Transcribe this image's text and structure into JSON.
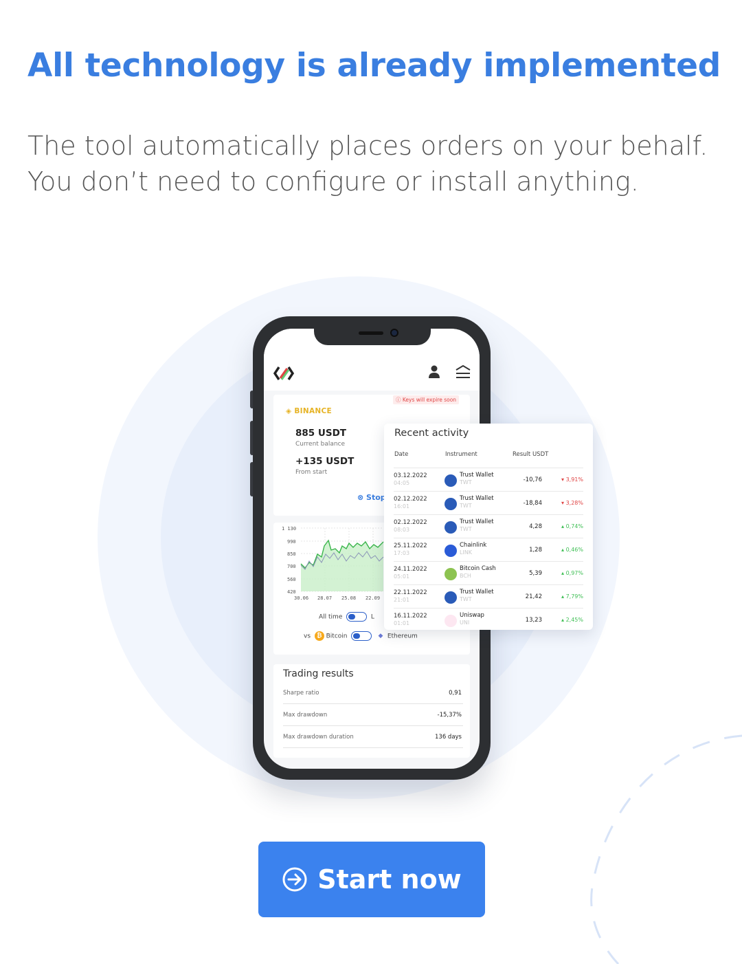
{
  "headline": "All technology is already implemented",
  "subtext": {
    "line1": "The tool automatically places orders on your behalf.",
    "line2": "You don’t need to configure or install anything."
  },
  "colors": {
    "brand_blue": "#3a7ee0",
    "cta_blue": "#3b82ee",
    "positive": "#3fbf55",
    "negative": "#e04545",
    "binance_gold": "#e6b325"
  },
  "phone": {
    "header_icons": [
      "user-icon",
      "menu-icon"
    ],
    "exchange": {
      "name": "BINANCE",
      "warning": "ⓘ Keys will expire soon",
      "balance": "885 USDT",
      "balance_label": "Current balance",
      "profit": "+135 USDT",
      "profit_label": "From start",
      "stop_label": "⊗ Stop"
    },
    "chart": {
      "y_ticks": [
        "1 130",
        "990",
        "850",
        "700",
        "560",
        "420"
      ],
      "x_ticks": [
        "30.06",
        "28.07",
        "25.08",
        "22.09"
      ],
      "toggle_all_time": "All time",
      "toggle_all_time_extra": "L",
      "vs_label": "vs",
      "coin_bitcoin": "Bitcoin",
      "coin_ethereum": "Ethereum"
    },
    "trading_results": {
      "title": "Trading results",
      "rows": [
        {
          "label": "Sharpe ratio",
          "value": "0,91"
        },
        {
          "label": "Max drawdown",
          "value": "-15,37%"
        },
        {
          "label": "Max drawdown duration",
          "value": "136 days"
        }
      ]
    }
  },
  "recent_activity": {
    "title": "Recent activity",
    "headers": {
      "date": "Date",
      "instrument": "Instrument",
      "result": "Result USDT"
    },
    "rows": [
      {
        "date": "03.12.2022",
        "time": "04:05",
        "name": "Trust Wallet",
        "sym": "TWT",
        "result": "-10,76",
        "pct": "▾ 3,91%",
        "dir": "neg",
        "icon": "trust-wallet-icon"
      },
      {
        "date": "02.12.2022",
        "time": "16:01",
        "name": "Trust Wallet",
        "sym": "TWT",
        "result": "-18,84",
        "pct": "▾ 3,28%",
        "dir": "neg",
        "icon": "trust-wallet-icon"
      },
      {
        "date": "02.12.2022",
        "time": "08:03",
        "name": "Trust Wallet",
        "sym": "TWT",
        "result": "4,28",
        "pct": "▴ 0,74%",
        "dir": "pos",
        "icon": "trust-wallet-icon"
      },
      {
        "date": "25.11.2022",
        "time": "17:03",
        "name": "Chainlink",
        "sym": "LINK",
        "result": "1,28",
        "pct": "▴ 0,46%",
        "dir": "pos",
        "icon": "chainlink-icon"
      },
      {
        "date": "24.11.2022",
        "time": "05:01",
        "name": "Bitcoin Cash",
        "sym": "BCH",
        "result": "5,39",
        "pct": "▴ 0,97%",
        "dir": "pos",
        "icon": "bitcoin-cash-icon"
      },
      {
        "date": "22.11.2022",
        "time": "21:01",
        "name": "Trust Wallet",
        "sym": "TWT",
        "result": "21,42",
        "pct": "▴ 7,79%",
        "dir": "pos",
        "icon": "trust-wallet-icon"
      },
      {
        "date": "16.11.2022",
        "time": "01:01",
        "name": "Uniswap",
        "sym": "UNI",
        "result": "13,23",
        "pct": "▴ 2,45%",
        "dir": "pos",
        "icon": "uniswap-icon"
      }
    ]
  },
  "cta": {
    "label": "Start now",
    "icon": "arrow-right-circle-icon"
  }
}
